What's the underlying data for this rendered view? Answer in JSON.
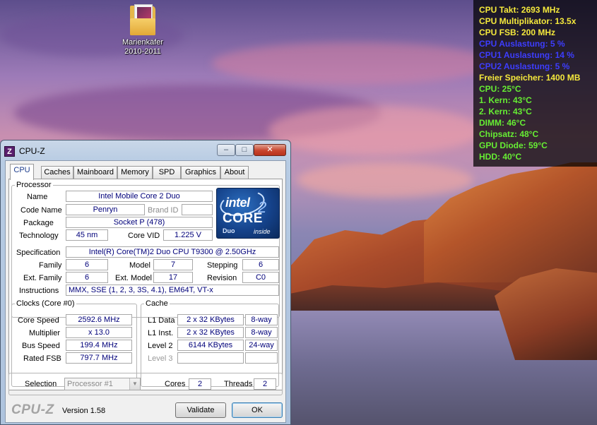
{
  "desktop": {
    "icon_label_line1": "Marienkäfer",
    "icon_label_line2": "2010-2011",
    "icon": "folder-icon"
  },
  "gadget": {
    "lines": [
      {
        "text": "CPU Takt: 2693 MHz",
        "color": "#f5e93c"
      },
      {
        "text": "CPU Multiplikator: 13.5x",
        "color": "#f5e93c"
      },
      {
        "text": "CPU FSB: 200 MHz",
        "color": "#f5e93c"
      },
      {
        "text": "CPU Auslastung: 5 %",
        "color": "#3d3dff"
      },
      {
        "text": "CPU1 Auslastung: 14 %",
        "color": "#3d3dff"
      },
      {
        "text": "CPU2 Auslastung: 5 %",
        "color": "#3d3dff"
      },
      {
        "text": "Freier Speicher: 1400 MB",
        "color": "#f5e93c"
      },
      {
        "text": "CPU: 25°C",
        "color": "#66ee33"
      },
      {
        "text": "1. Kern: 43°C",
        "color": "#66ee33"
      },
      {
        "text": "2. Kern: 43°C",
        "color": "#66ee33"
      },
      {
        "text": "DIMM: 46°C",
        "color": "#66ee33"
      },
      {
        "text": "Chipsatz: 48°C",
        "color": "#66ee33"
      },
      {
        "text": "GPU Diode: 59°C",
        "color": "#66ee33"
      },
      {
        "text": "HDD: 40°C",
        "color": "#66ee33"
      }
    ]
  },
  "window": {
    "title": "CPU-Z",
    "logo": "Z",
    "controls": {
      "minimize": "‒",
      "maximize": "□",
      "close": "✕"
    },
    "tabs": [
      "CPU",
      "Caches",
      "Mainboard",
      "Memory",
      "SPD",
      "Graphics",
      "About"
    ],
    "active_tab": "CPU"
  },
  "processor": {
    "legend": "Processor",
    "name_label": "Name",
    "name": "Intel Mobile Core 2 Duo",
    "codename_label": "Code Name",
    "codename": "Penryn",
    "brandid_label": "Brand ID",
    "brandid": "",
    "package_label": "Package",
    "package": "Socket P (478)",
    "technology_label": "Technology",
    "technology": "45 nm",
    "corevid_label": "Core VID",
    "corevid": "1.225 V",
    "spec_label": "Specification",
    "spec": "Intel(R) Core(TM)2 Duo CPU      T9300  @ 2.50GHz",
    "family_label": "Family",
    "family": "6",
    "model_label": "Model",
    "model": "7",
    "stepping_label": "Stepping",
    "stepping": "6",
    "extfamily_label": "Ext. Family",
    "extfamily": "6",
    "extmodel_label": "Ext. Model",
    "extmodel": "17",
    "revision_label": "Revision",
    "revision": "C0",
    "instructions_label": "Instructions",
    "instructions": "MMX, SSE (1, 2, 3, 3S, 4.1), EM64T, VT-x",
    "logo": {
      "brand": "intel",
      "core": "CORE",
      "two": "2",
      "duo": "Duo",
      "inside": "inside"
    }
  },
  "clocks": {
    "legend": "Clocks (Core #0)",
    "corespeed_label": "Core Speed",
    "corespeed": "2592.6 MHz",
    "multiplier_label": "Multiplier",
    "multiplier": "x 13.0",
    "busspeed_label": "Bus Speed",
    "busspeed": "199.4 MHz",
    "ratedfsb_label": "Rated FSB",
    "ratedfsb": "797.7 MHz"
  },
  "cache": {
    "legend": "Cache",
    "l1data_label": "L1 Data",
    "l1data": "2 x 32 KBytes",
    "l1data_way": "8-way",
    "l1inst_label": "L1 Inst.",
    "l1inst": "2 x 32 KBytes",
    "l1inst_way": "8-way",
    "level2_label": "Level 2",
    "level2": "6144 KBytes",
    "level2_way": "24-way",
    "level3_label": "Level 3",
    "level3": "",
    "level3_way": ""
  },
  "selection": {
    "label": "Selection",
    "value": "Processor #1",
    "cores_label": "Cores",
    "cores": "2",
    "threads_label": "Threads",
    "threads": "2"
  },
  "footer": {
    "brand": "CPU-Z",
    "version": "Version 1.58",
    "validate": "Validate",
    "ok": "OK"
  }
}
